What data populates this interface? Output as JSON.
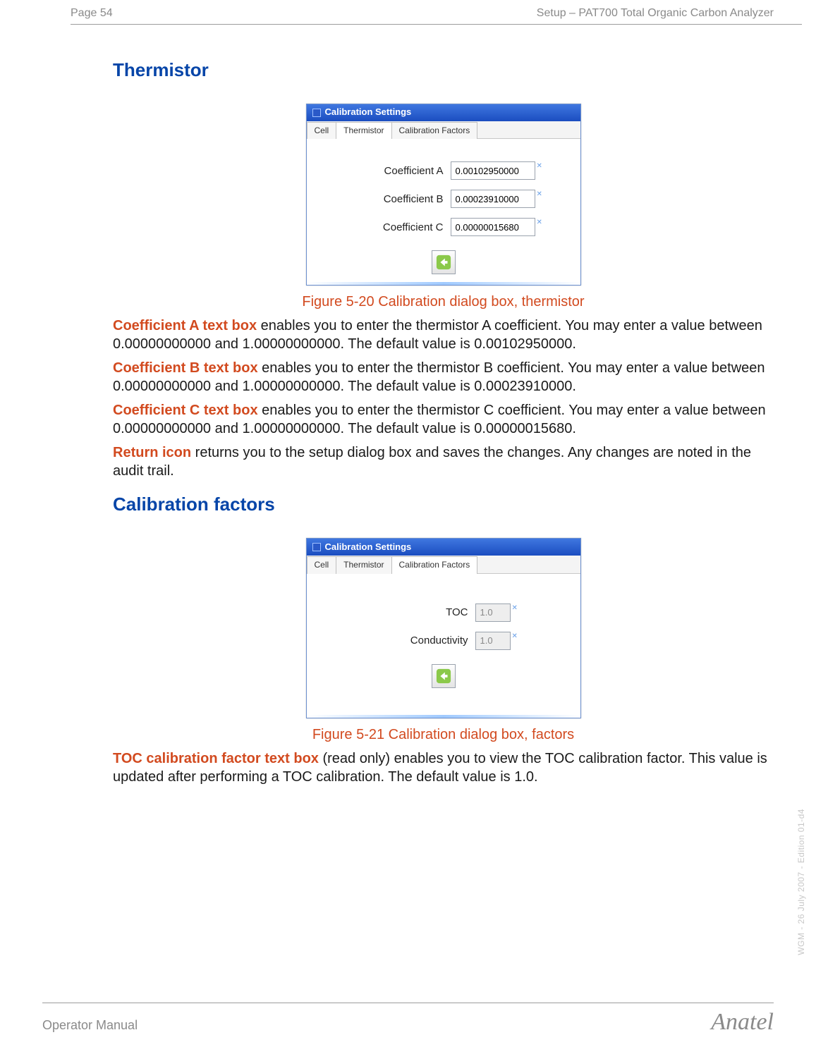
{
  "header": {
    "page_number": "Page 54",
    "doc_section": "Setup – PAT700 Total Organic Carbon Analyzer"
  },
  "thermistor": {
    "heading": "Thermistor",
    "dialog": {
      "title": "Calibration Settings",
      "tabs": {
        "cell": "Cell",
        "thermistor": "Thermistor",
        "factors": "Calibration Factors"
      },
      "labels": {
        "coeff_a": "Coefficient A",
        "coeff_b": "Coefficient B",
        "coeff_c": "Coefficient C"
      },
      "values": {
        "coeff_a": "0.00102950000",
        "coeff_b": "0.00023910000",
        "coeff_c": "0.00000015680"
      }
    },
    "caption": "Figure 5-20 Calibration dialog box, thermistor",
    "para_a_lead": "Coefficient A text box",
    "para_a_rest": " enables you to enter the thermistor A coefficient. You may enter a value between 0.00000000000 and 1.00000000000. The default value is 0.00102950000.",
    "para_b_lead": "Coefficient B text box",
    "para_b_rest": " enables you to enter the thermistor B coefficient. You may enter a value between 0.00000000000 and 1.00000000000. The default value is 0.00023910000.",
    "para_c_lead": "Coefficient C text box",
    "para_c_rest": " enables you to enter the thermistor C coefficient. You may enter a value between 0.00000000000 and 1.00000000000. The default value is 0.00000015680.",
    "para_return_lead": "Return icon",
    "para_return_rest": " returns you to the setup dialog box and saves the changes. Any changes are noted in the audit trail."
  },
  "factors": {
    "heading": "Calibration factors",
    "dialog": {
      "title": "Calibration Settings",
      "tabs": {
        "cell": "Cell",
        "thermistor": "Thermistor",
        "factors": "Calibration Factors"
      },
      "labels": {
        "toc": "TOC",
        "cond": "Conductivity"
      },
      "values": {
        "toc": "1.0",
        "cond": "1.0"
      }
    },
    "caption": "Figure 5-21 Calibration dialog box, factors",
    "para_toc_lead": "TOC calibration factor text box",
    "para_toc_rest": " (read only) enables you to view the TOC calibration factor. This value is updated after performing a TOC calibration. The default value is 1.0."
  },
  "footer": {
    "left": "Operator Manual",
    "right": "Anatel"
  },
  "side_note": "WGM - 26 July 2007 - Edition 01-d4"
}
